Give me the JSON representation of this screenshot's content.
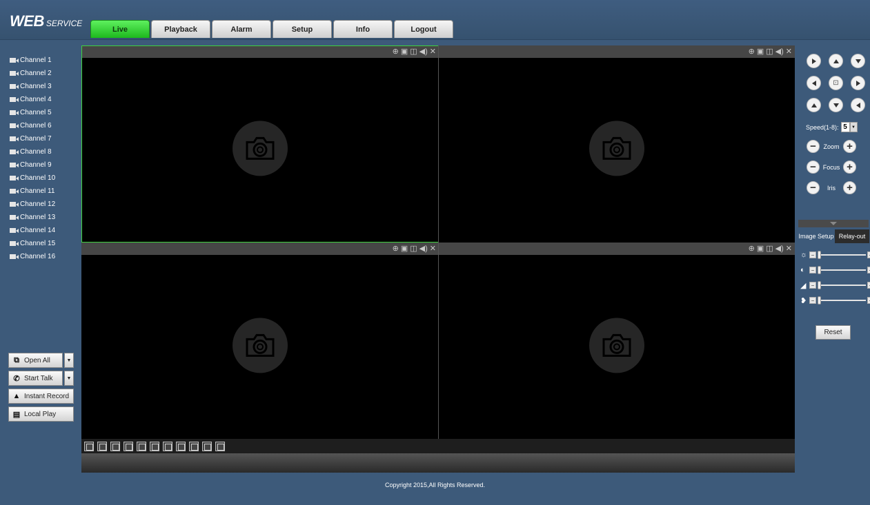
{
  "header": {
    "logo_main": "WEB",
    "logo_sub": "SERVICE",
    "tabs": [
      {
        "label": "Live"
      },
      {
        "label": "Playback"
      },
      {
        "label": "Alarm"
      },
      {
        "label": "Setup"
      },
      {
        "label": "Info"
      },
      {
        "label": "Logout"
      }
    ],
    "active_tab": "Live",
    "active_tab_color": "#2fd12f"
  },
  "channels": [
    "Channel 1",
    "Channel 2",
    "Channel 3",
    "Channel 4",
    "Channel 5",
    "Channel 6",
    "Channel 7",
    "Channel 8",
    "Channel 9",
    "Channel 10",
    "Channel 11",
    "Channel 12",
    "Channel 13",
    "Channel 14",
    "Channel 15",
    "Channel 16"
  ],
  "left_buttons": {
    "open_all": "Open All",
    "start_talk": "Start Talk",
    "instant_record": "Instant Record",
    "local_play": "Local Play"
  },
  "ptz": {
    "speed_label": "Speed(1-8):",
    "speed_value": "5",
    "zoom": "Zoom",
    "focus": "Focus",
    "iris": "Iris"
  },
  "side_tabs": {
    "image_setup": "Image Setup",
    "relay_out": "Relay-out"
  },
  "image_sliders": [
    {
      "icon": "brightness-icon",
      "glyph": "☼"
    },
    {
      "icon": "contrast-icon",
      "glyph": "◐"
    },
    {
      "icon": "saturation-icon",
      "glyph": "◢"
    },
    {
      "icon": "hue-icon",
      "glyph": "❥"
    }
  ],
  "reset_label": "Reset",
  "footer": {
    "copyright": "Copyright 2015,All Rights Reserved."
  },
  "colors": {
    "background": "#3d5a7a",
    "selected_pane_border": "#3ed23e"
  }
}
